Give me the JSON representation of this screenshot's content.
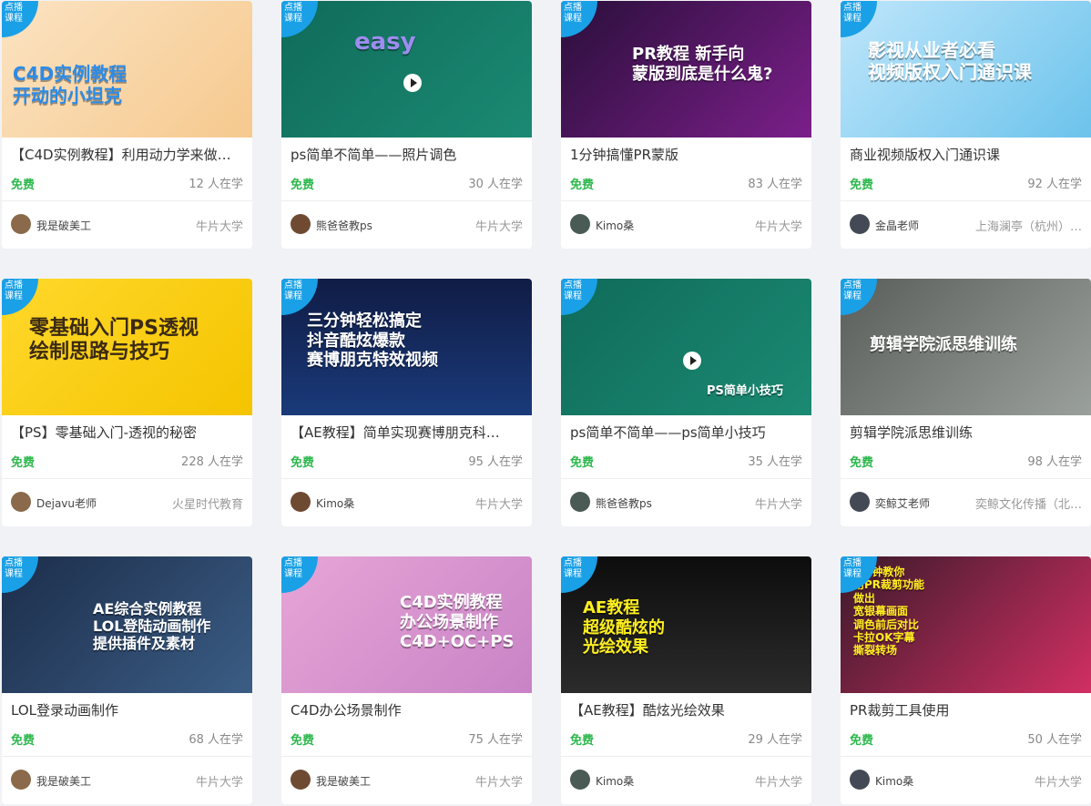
{
  "cards": [
    {
      "badge": "点播\n课程",
      "art": "C4D实例教程\n开动的小坦克",
      "title": "【C4D实例教程】利用动力学来做…",
      "price": "免费",
      "learners": "12 人在学",
      "teacher": "我是破美工",
      "org": "牛片大学"
    },
    {
      "badge": "点播\n课程",
      "art": "easy",
      "title": "ps简单不简单——照片调色",
      "price": "免费",
      "learners": "30 人在学",
      "teacher": "熊爸爸教ps",
      "org": "牛片大学"
    },
    {
      "badge": "点播\n课程",
      "art": "PR教程 新手向\n蒙版到底是什么鬼?",
      "title": "1分钟搞懂PR蒙版",
      "price": "免费",
      "learners": "83 人在学",
      "teacher": "Kimo桑",
      "org": "牛片大学"
    },
    {
      "badge": "点播\n课程",
      "art": "影视从业者必看\n视频版权入门通识课",
      "title": "商业视频版权入门通识课",
      "price": "免费",
      "learners": "92 人在学",
      "teacher": "金晶老师",
      "org": "上海澜亭（杭州）…"
    },
    {
      "badge": "点播\n课程",
      "art": "零基础入门PS透视\n绘制思路与技巧",
      "title": "【PS】零基础入门-透视的秘密",
      "price": "免费",
      "learners": "228 人在学",
      "teacher": "Dejavu老师",
      "org": "火星时代教育"
    },
    {
      "badge": "点播\n课程",
      "art": "三分钟轻松搞定\n抖音酷炫爆款\n赛博朋克特效视频",
      "title": "【AE教程】简单实现赛博朋克科…",
      "price": "免费",
      "learners": "95 人在学",
      "teacher": "Kimo桑",
      "org": "牛片大学"
    },
    {
      "badge": "点播\n课程",
      "art": "PS简单小技巧",
      "title": "ps简单不简单——ps简单小技巧",
      "price": "免费",
      "learners": "35 人在学",
      "teacher": "熊爸爸教ps",
      "org": "牛片大学"
    },
    {
      "badge": "点播\n课程",
      "art": "剪辑学院派思维训练",
      "title": "剪辑学院派思维训练",
      "price": "免费",
      "learners": "98 人在学",
      "teacher": "奕鲸艾老师",
      "org": "奕鲸文化传播（北…"
    },
    {
      "badge": "点播\n课程",
      "art": "AE综合实例教程\nLOL登陆动画制作\n提供插件及素材",
      "title": "LOL登录动画制作",
      "price": "免费",
      "learners": "68 人在学",
      "teacher": "我是破美工",
      "org": "牛片大学"
    },
    {
      "badge": "点播\n课程",
      "art": "C4D实例教程\n办公场景制作\nC4D+OC+PS",
      "title": "C4D办公场景制作",
      "price": "免费",
      "learners": "75 人在学",
      "teacher": "我是破美工",
      "org": "牛片大学"
    },
    {
      "badge": "点播\n课程",
      "art": "AE教程\n超级酷炫的\n光绘效果",
      "title": "【AE教程】酷炫光绘效果",
      "price": "免费",
      "learners": "29 人在学",
      "teacher": "Kimo桑",
      "org": "牛片大学"
    },
    {
      "badge": "点播\n课程",
      "art": "4分钟教你\n用PR裁剪功能\n做出\n宽银幕画面\n调色前后对比\n卡拉OK字幕\n撕裂转场",
      "title": "PR裁剪工具使用",
      "price": "免费",
      "learners": "50 人在学",
      "teacher": "Kimo桑",
      "org": "牛片大学"
    }
  ],
  "colors": {
    "accent": "#1aa0e6",
    "free": "#2db84d"
  }
}
